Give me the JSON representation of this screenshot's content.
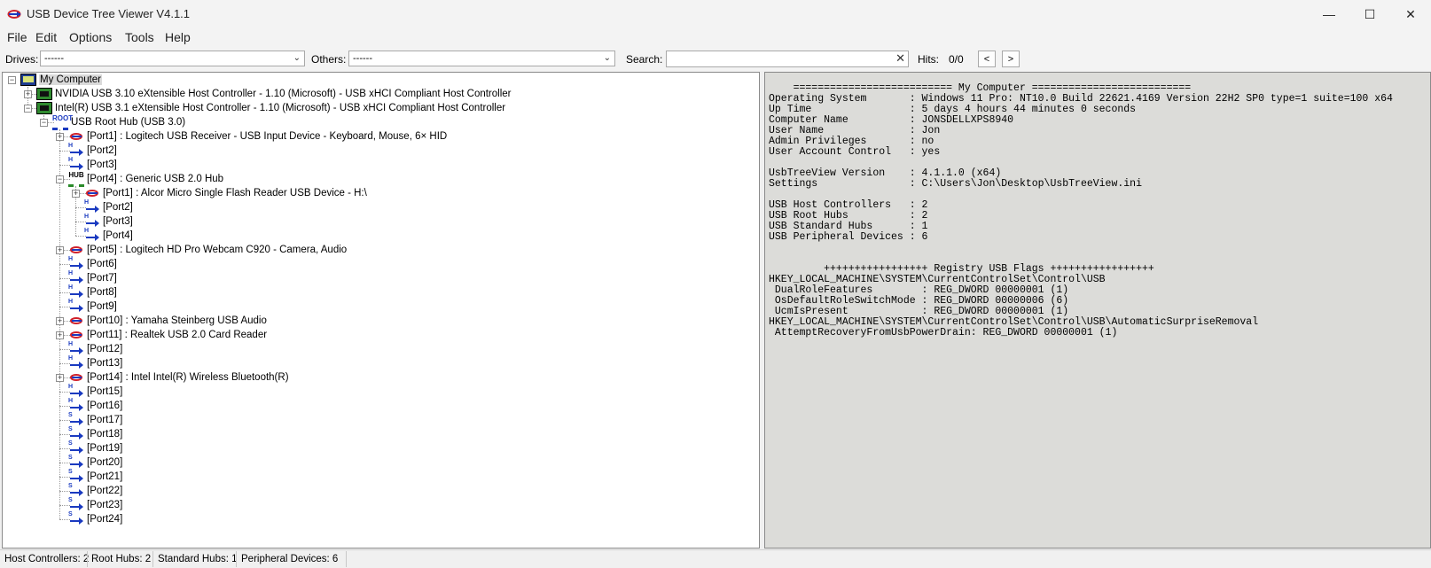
{
  "window": {
    "title": "USB Device Tree Viewer V4.1.1",
    "minimize_glyph": "—",
    "maximize_glyph": "☐",
    "close_glyph": "✕"
  },
  "menu": [
    "File",
    "Edit",
    "Options",
    "Tools",
    "Help"
  ],
  "toolbar": {
    "drives_label": "Drives:",
    "drives_value": "------",
    "others_label": "Others:",
    "others_value": "------",
    "search_label": "Search:",
    "search_value": "",
    "hits_label": "Hits:",
    "hits_value": "0/0",
    "prev_glyph": "<",
    "next_glyph": ">"
  },
  "tree": [
    {
      "label": "My Computer",
      "icon": "computer-icon",
      "level": 0
    },
    {
      "label": "NVIDIA USB 3.10 eXtensible Host Controller - 1.10 (Microsoft) - USB xHCI Compliant Host Controller",
      "icon": "host-controller-icon",
      "level": 1
    },
    {
      "label": "Intel(R) USB 3.1 eXtensible Host Controller - 1.10 (Microsoft) - USB xHCI Compliant Host Controller",
      "icon": "host-controller-icon",
      "level": 1
    },
    {
      "label": "USB Root Hub (USB 3.0)",
      "icon": "root-hub-icon",
      "icon_text": "ROOT",
      "level": 2
    },
    {
      "label": "[Port1] : Logitech USB Receiver - USB Input Device - Keyboard, Mouse, 6× HID",
      "icon": "usb-device-icon",
      "level": 3
    },
    {
      "label": "[Port2]",
      "icon": "usb-port-icon",
      "level": 3
    },
    {
      "label": "[Port3]",
      "icon": "usb-port-icon",
      "level": 3
    },
    {
      "label": "[Port4] : Generic USB 2.0 Hub",
      "icon": "usb-hub-icon",
      "icon_text": "HUB",
      "level": 3
    },
    {
      "label": "[Port1] : Alcor Micro Single Flash Reader USB Device - H:\\",
      "icon": "usb-device-icon",
      "level": 4
    },
    {
      "label": "[Port2]",
      "icon": "usb-port-icon",
      "level": 4
    },
    {
      "label": "[Port3]",
      "icon": "usb-port-icon",
      "level": 4
    },
    {
      "label": "[Port4]",
      "icon": "usb-port-icon",
      "level": 4
    },
    {
      "label": "[Port5] : Logitech HD Pro Webcam C920 - Camera, Audio",
      "icon": "usb-device-icon",
      "level": 3
    },
    {
      "label": "[Port6]",
      "icon": "usb-port-icon",
      "level": 3
    },
    {
      "label": "[Port7]",
      "icon": "usb-port-icon",
      "level": 3
    },
    {
      "label": "[Port8]",
      "icon": "usb-port-icon",
      "level": 3
    },
    {
      "label": "[Port9]",
      "icon": "usb-port-icon",
      "level": 3
    },
    {
      "label": "[Port10] : Yamaha Steinberg USB Audio",
      "icon": "usb-device-icon",
      "level": 3
    },
    {
      "label": "[Port11] : Realtek USB 2.0 Card Reader",
      "icon": "usb-device-icon",
      "level": 3
    },
    {
      "label": "[Port12]",
      "icon": "usb-port-icon",
      "level": 3
    },
    {
      "label": "[Port13]",
      "icon": "usb-port-icon",
      "level": 3
    },
    {
      "label": "[Port14] : Intel Intel(R) Wireless Bluetooth(R)",
      "icon": "usb-device-icon",
      "level": 3
    },
    {
      "label": "[Port15]",
      "icon": "usb-port-icon",
      "level": 3
    },
    {
      "label": "[Port16]",
      "icon": "usb-port-icon",
      "level": 3
    },
    {
      "label": "[Port17]",
      "icon": "superspeed-port-icon",
      "level": 3
    },
    {
      "label": "[Port18]",
      "icon": "superspeed-port-icon",
      "level": 3
    },
    {
      "label": "[Port19]",
      "icon": "superspeed-port-icon",
      "level": 3
    },
    {
      "label": "[Port20]",
      "icon": "superspeed-port-icon",
      "level": 3
    },
    {
      "label": "[Port21]",
      "icon": "superspeed-port-icon",
      "level": 3
    },
    {
      "label": "[Port22]",
      "icon": "superspeed-port-icon",
      "level": 3
    },
    {
      "label": "[Port23]",
      "icon": "superspeed-port-icon",
      "level": 3
    },
    {
      "label": "[Port24]",
      "icon": "superspeed-port-icon",
      "level": 3
    }
  ],
  "report": [
    "    ========================== My Computer ==========================",
    "Operating System       : Windows 11 Pro: NT10.0 Build 22621.4169 Version 22H2 SP0 type=1 suite=100 x64",
    "Up Time                : 5 days 4 hours 44 minutes 0 seconds",
    "Computer Name          : JONSDELLXPS8940",
    "User Name              : Jon",
    "Admin Privileges       : no",
    "User Account Control   : yes",
    "",
    "UsbTreeView Version    : 4.1.1.0 (x64)",
    "Settings               : C:\\Users\\Jon\\Desktop\\UsbTreeView.ini",
    "",
    "USB Host Controllers   : 2",
    "USB Root Hubs          : 2",
    "USB Standard Hubs      : 1",
    "USB Peripheral Devices : 6",
    "",
    "",
    "         +++++++++++++++++ Registry USB Flags +++++++++++++++++",
    "HKEY_LOCAL_MACHINE\\SYSTEM\\CurrentControlSet\\Control\\USB",
    " DualRoleFeatures        : REG_DWORD 00000001 (1)",
    " OsDefaultRoleSwitchMode : REG_DWORD 00000006 (6)",
    " UcmIsPresent            : REG_DWORD 00000001 (1)",
    "HKEY_LOCAL_MACHINE\\SYSTEM\\CurrentControlSet\\Control\\USB\\AutomaticSurpriseRemoval",
    " AttemptRecoveryFromUsbPowerDrain: REG_DWORD 00000001 (1)"
  ],
  "status": {
    "host_controllers": "Host Controllers: 2",
    "root_hubs": "Root Hubs: 2",
    "standard_hubs": "Standard Hubs: 1",
    "peripheral_devices": "Peripheral Devices: 6"
  }
}
